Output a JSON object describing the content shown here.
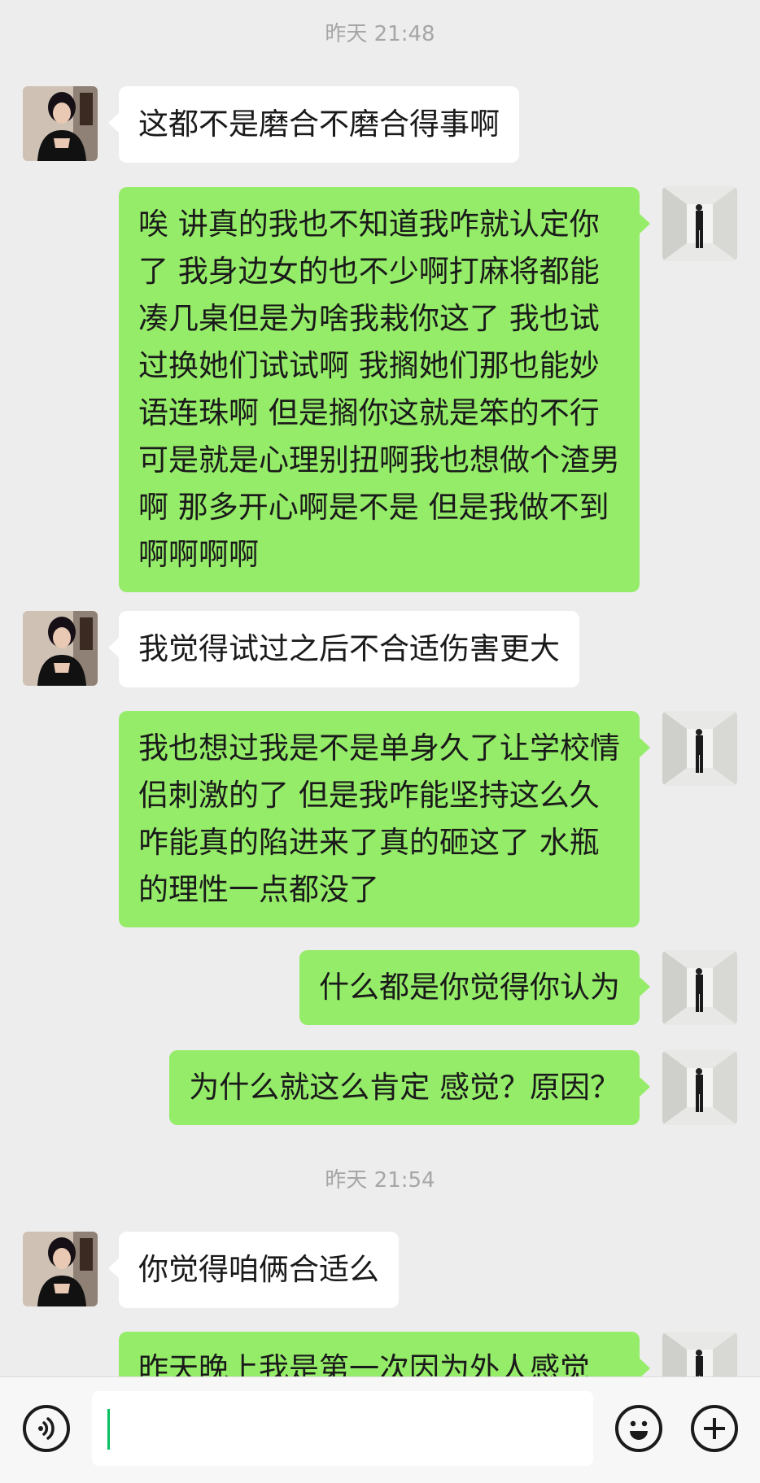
{
  "chat": {
    "timestamps": [
      "昨天 21:48",
      "昨天 21:54"
    ],
    "messages": [
      {
        "side": "left",
        "text": "这都不是磨合不磨合得事啊"
      },
      {
        "side": "right",
        "text": "唉 讲真的我也不知道我咋就认定你了 我身边女的也不少啊打麻将都能凑几桌但是为啥我栽你这了 我也试过换她们试试啊 我搁她们那也能妙语连珠啊 但是搁你这就是笨的不行 可是就是心理别扭啊我也想做个渣男啊 那多开心啊是不是 但是我做不到啊啊啊啊"
      },
      {
        "side": "left",
        "text": "我觉得试过之后不合适伤害更大"
      },
      {
        "side": "right",
        "text": "我也想过我是不是单身久了让学校情侣刺激的了 但是我咋能坚持这么久咋能真的陷进来了真的砸这了 水瓶的理性一点都没了"
      },
      {
        "side": "right",
        "text": "什么都是你觉得你认为"
      },
      {
        "side": "right",
        "text": "为什么就这么肯定 感觉？原因？"
      },
      {
        "side": "left",
        "text": "你觉得咱俩合适么"
      },
      {
        "side": "right",
        "text": "昨天晚上我是第一次因为外人感觉"
      }
    ]
  },
  "input_bar": {
    "voice_icon": "voice-icon",
    "emoji_icon": "emoji-icon",
    "plus_icon": "plus-icon",
    "value": ""
  },
  "colors": {
    "background": "#ededed",
    "bubble_self": "#95ec69",
    "bubble_other": "#ffffff",
    "cursor": "#07c160"
  }
}
